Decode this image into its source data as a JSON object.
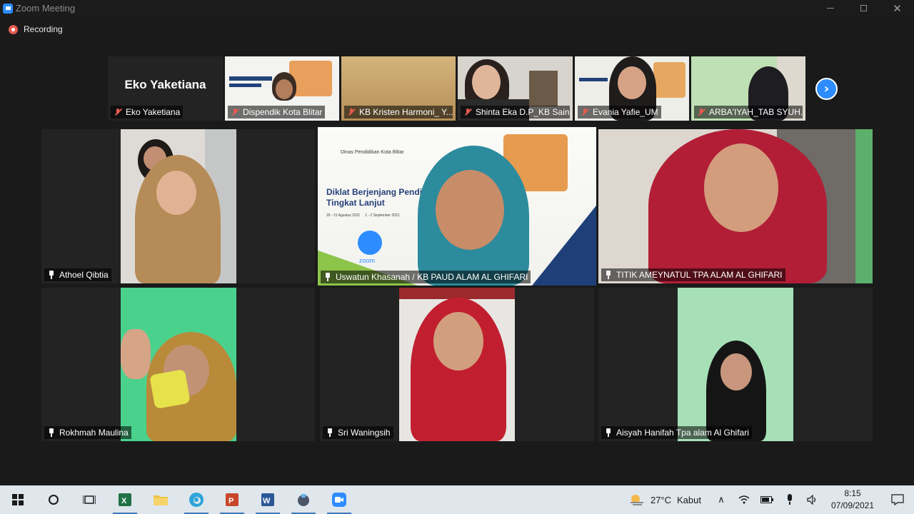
{
  "window": {
    "title": "Zoom Meeting"
  },
  "recording": {
    "label": "Recording"
  },
  "top_strip": {
    "participants": [
      {
        "name": "Eko Yaketiana",
        "mic": "muted",
        "video": false
      },
      {
        "name": "Dispendik Kota Blitar",
        "mic": "muted",
        "video": true
      },
      {
        "name": "KB Kristen Harmoni_ Y...",
        "mic": "muted",
        "video": true
      },
      {
        "name": "Shinta Eka D.P_KB Sain...",
        "mic": "muted",
        "video": true
      },
      {
        "name": "Evania Yafie_UM",
        "mic": "muted",
        "video": true
      },
      {
        "name": "ARBA'IYAH_TAB SYUH...",
        "mic": "muted",
        "video": true
      }
    ],
    "next_label": "›"
  },
  "gallery": [
    {
      "name": "Athoel Qibtia",
      "active": false
    },
    {
      "name": "Uswatun Khasanah / KB PAUD ALAM AL GHIFARI",
      "active": true
    },
    {
      "name": "TITIK AMEYNATUL TPA ALAM AL GHIFARI",
      "active": false
    },
    {
      "name": "Rokhmah Maulina",
      "active": false
    },
    {
      "name": "Sri Waningsih",
      "active": false
    },
    {
      "name": "Aisyah Hanifah Tpa alam Al Ghifari",
      "active": false
    }
  ],
  "slide": {
    "header": "Dinas Pendidikan Kota Blitar",
    "title_line1": "Diklat Berjenjang Pendidik",
    "title_line2": "Tingkat Lanjut",
    "dates": "20 - 21 Agustus 2021     1 - 2 September 2021",
    "zoom_label": "zoom"
  },
  "taskbar": {
    "weather_temp": "27°C",
    "weather_text": "Kabut",
    "time": "8:15",
    "date": "07/09/2021"
  },
  "colors": {
    "zoom_blue": "#2d8cff",
    "muted_red": "#e35b4f",
    "active_speaker": "#d6e76c"
  }
}
